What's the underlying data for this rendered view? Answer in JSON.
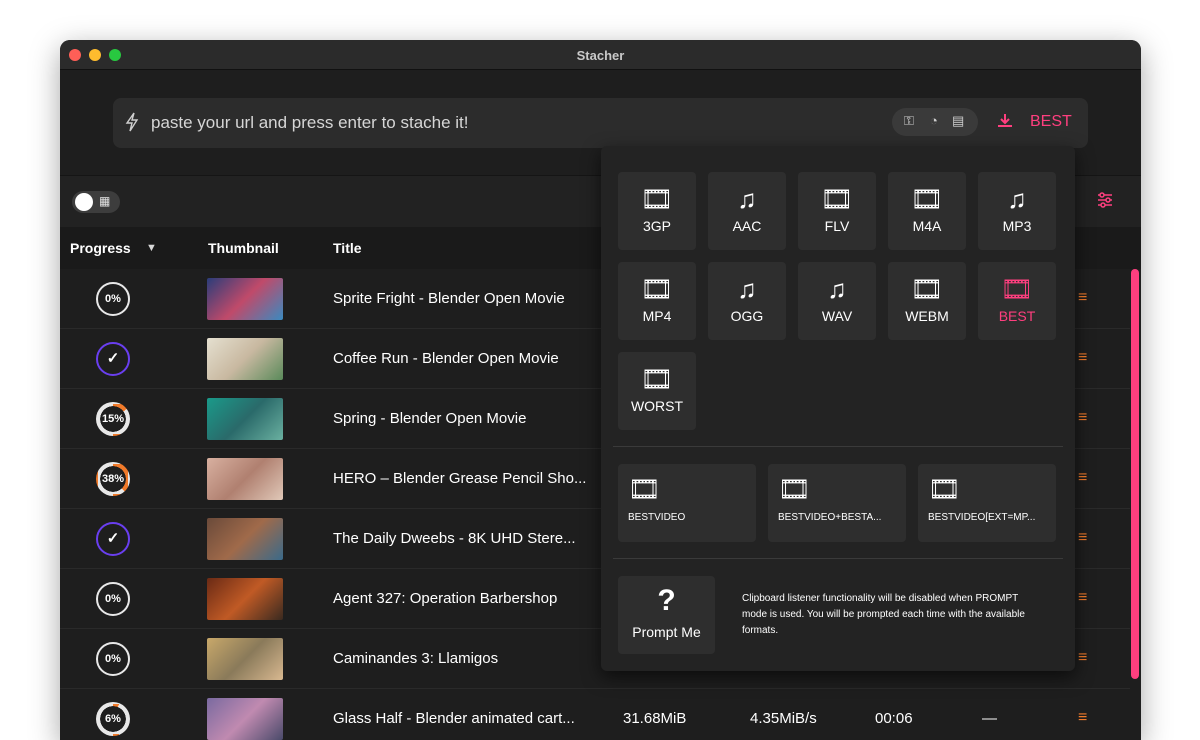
{
  "window": {
    "title": "Stacher"
  },
  "urlbar": {
    "placeholder": "paste your url and press enter to stache it!",
    "format_label": "BEST",
    "icons": [
      "bolt-icon",
      "key-icon",
      "cookie-icon",
      "archive-icon",
      "download-icon"
    ]
  },
  "toolbar": {
    "icons": [
      "toggle-switch",
      "grid-icon",
      "settings-sliders-icon"
    ]
  },
  "table": {
    "headers": {
      "progress": "Progress",
      "thumbnail": "Thumbnail",
      "title": "Title"
    },
    "rows": [
      {
        "progress": "0%",
        "state": "pending",
        "progress_value": 0,
        "title": "Sprite Fright - Blender Open Movie",
        "thumb_color": "#3a5fa8"
      },
      {
        "progress": "✓",
        "state": "done",
        "progress_value": 100,
        "title": "Coffee Run - Blender Open Movie",
        "thumb_color": "#d8d2c2"
      },
      {
        "progress": "15%",
        "state": "partial",
        "progress_value": 15,
        "title": "Spring - Blender Open Movie",
        "thumb_color": "#1f8a7e"
      },
      {
        "progress": "38%",
        "state": "partial",
        "progress_value": 38,
        "title": "HERO – Blender Grease Pencil Sho...",
        "thumb_color": "#c99b86"
      },
      {
        "progress": "✓",
        "state": "done",
        "progress_value": 100,
        "title": "The Daily Dweebs - 8K UHD Stere...",
        "thumb_color": "#8a5a3a"
      },
      {
        "progress": "0%",
        "state": "pending",
        "progress_value": 0,
        "title": "Agent 327: Operation Barbershop",
        "thumb_color": "#9a4a25"
      },
      {
        "progress": "0%",
        "state": "pending",
        "progress_value": 0,
        "title": "Caminandes 3: Llamigos",
        "thumb_color": "#b89a5a"
      },
      {
        "progress": "6%",
        "state": "partial",
        "progress_value": 6,
        "title": "Glass Half - Blender animated cart...",
        "thumb_color": "#6a5a8a",
        "size": "31.68MiB",
        "speed": "4.35MiB/s",
        "eta": "00:06",
        "extra": "—"
      }
    ]
  },
  "format_menu": {
    "formats": [
      {
        "label": "3GP",
        "icon": "film-icon"
      },
      {
        "label": "AAC",
        "icon": "music-note-icon"
      },
      {
        "label": "FLV",
        "icon": "film-icon"
      },
      {
        "label": "M4A",
        "icon": "film-icon"
      },
      {
        "label": "MP3",
        "icon": "music-note-icon"
      },
      {
        "label": "MP4",
        "icon": "film-icon"
      },
      {
        "label": "OGG",
        "icon": "music-note-icon"
      },
      {
        "label": "WAV",
        "icon": "music-note-icon"
      },
      {
        "label": "WEBM",
        "icon": "film-icon"
      },
      {
        "label": "BEST",
        "icon": "film-icon",
        "selected": true
      },
      {
        "label": "WORST",
        "icon": "film-icon"
      }
    ],
    "wide_formats": [
      {
        "label": "BESTVIDEO",
        "icon": "film-icon"
      },
      {
        "label": "BESTVIDEO+BESTA...",
        "icon": "film-icon"
      },
      {
        "label": "BESTVIDEO[EXT=MP...",
        "icon": "film-icon"
      }
    ],
    "prompt": {
      "symbol": "?",
      "label": "Prompt Me",
      "note": "Clipboard listener functionality will be disabled when PROMPT mode is used. You will be prompted each time with the available formats."
    }
  },
  "colors": {
    "accent": "#ff3f7f",
    "done_ring": "#6a3ff0",
    "menu_icon": "#f07a2a"
  }
}
